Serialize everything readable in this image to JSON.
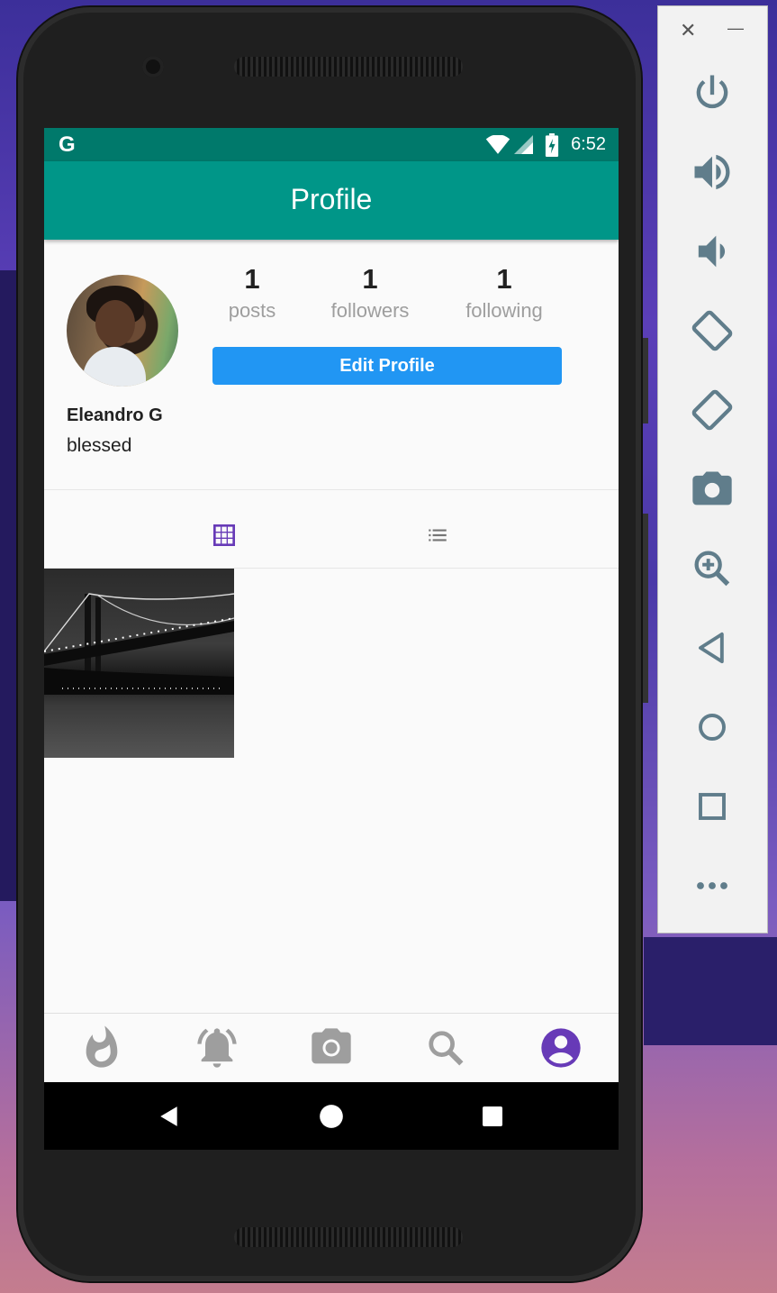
{
  "status_bar": {
    "google_label": "G",
    "time": "6:52"
  },
  "app_bar": {
    "title": "Profile"
  },
  "profile": {
    "name": "Eleandro G",
    "bio": "blessed",
    "stats": [
      {
        "value": "1",
        "label": "posts"
      },
      {
        "value": "1",
        "label": "followers"
      },
      {
        "value": "1",
        "label": "following"
      }
    ],
    "edit_button": "Edit Profile"
  },
  "tabs": [
    {
      "icon": "grid-icon",
      "active": true
    },
    {
      "icon": "list-icon",
      "active": false
    }
  ],
  "bottom_nav": [
    {
      "icon": "flame-icon",
      "active": false
    },
    {
      "icon": "bell-icon",
      "active": false
    },
    {
      "icon": "camera-icon",
      "active": false
    },
    {
      "icon": "search-icon",
      "active": false
    },
    {
      "icon": "account-icon",
      "active": true
    }
  ],
  "emulator_panel": {
    "close_glyph": "✕",
    "minimize_glyph": "—",
    "controls": [
      "power-icon",
      "volume-up-icon",
      "volume-down-icon",
      "rotate-left-icon",
      "rotate-right-icon",
      "screenshot-icon",
      "zoom-icon",
      "back-icon",
      "home-icon",
      "overview-icon",
      "more-icon"
    ]
  },
  "colors": {
    "accent": "#673ab7",
    "primary": "#009688",
    "primary_dark": "#00796b",
    "button": "#2196f3"
  }
}
